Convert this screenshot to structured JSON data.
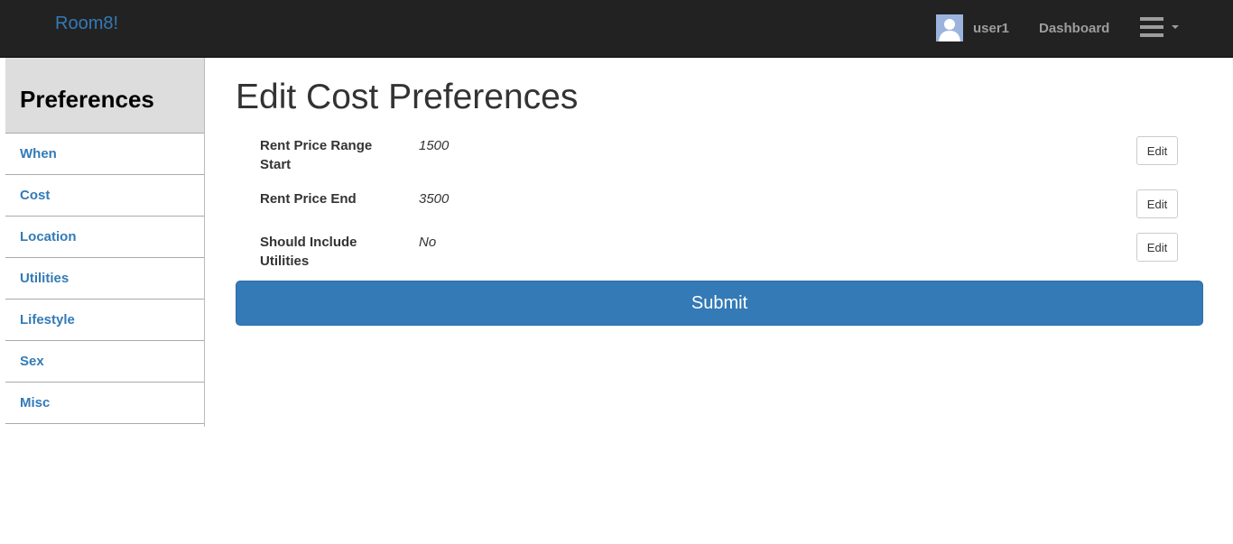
{
  "navbar": {
    "brand": "Room8!",
    "username": "user1",
    "dashboard": "Dashboard",
    "menu_icon": "hamburger-menu-icon",
    "avatar_icon": "user-avatar-icon"
  },
  "sidebar": {
    "title": "Preferences",
    "items": [
      {
        "label": "When"
      },
      {
        "label": "Cost"
      },
      {
        "label": "Location"
      },
      {
        "label": "Utilities"
      },
      {
        "label": "Lifestyle"
      },
      {
        "label": "Sex"
      },
      {
        "label": "Misc"
      }
    ]
  },
  "main": {
    "title": "Edit Cost Preferences",
    "preferences": [
      {
        "label": "Rent Price Range Start",
        "value": "1500",
        "edit_label": "Edit"
      },
      {
        "label": "Rent Price End",
        "value": "3500",
        "edit_label": "Edit"
      },
      {
        "label": "Should Include Utilities",
        "value": "No",
        "edit_label": "Edit"
      }
    ],
    "submit_label": "Submit"
  },
  "colors": {
    "navbar_bg": "#222222",
    "link": "#337ab7",
    "primary_button": "#337ab7",
    "sidebar_header_bg": "#dddddd"
  }
}
